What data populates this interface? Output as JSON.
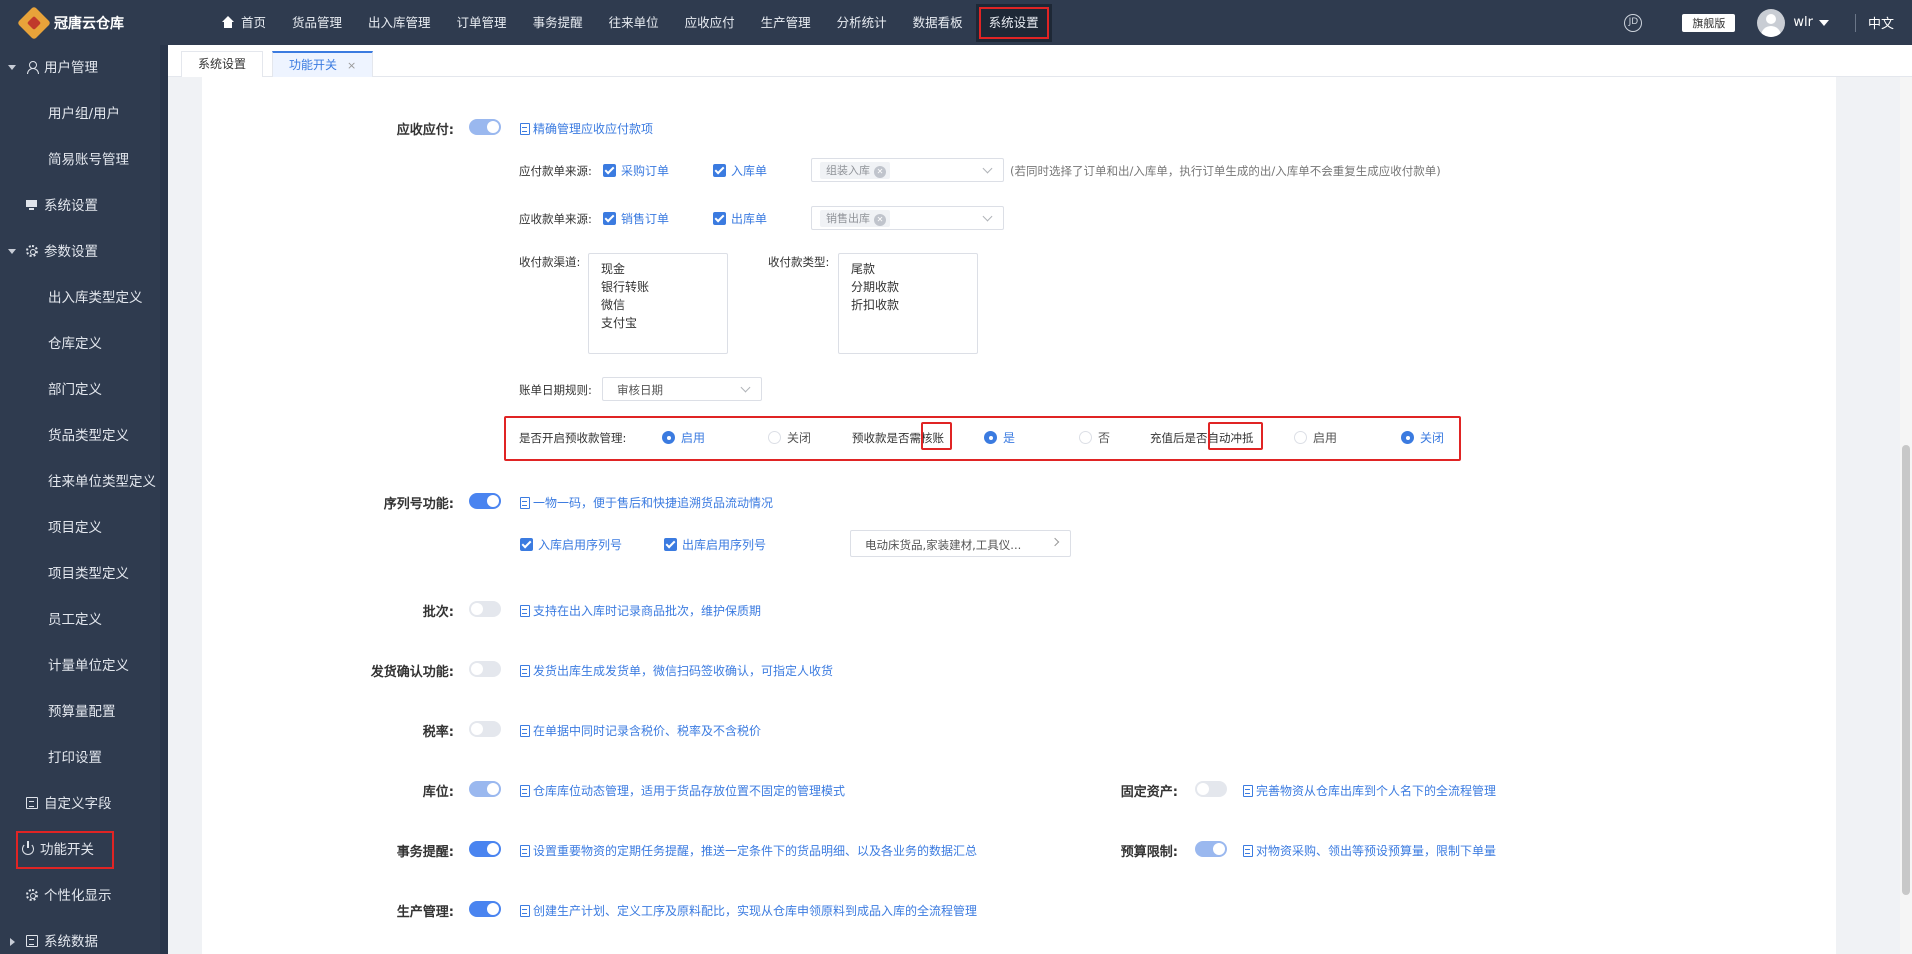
{
  "app": {
    "title": "冠唐云仓库"
  },
  "topnav": {
    "items": [
      "首页",
      "货品管理",
      "出入库管理",
      "订单管理",
      "事务提醒",
      "往来单位",
      "应收应付",
      "生产管理",
      "分析统计",
      "数据看板",
      "系统设置"
    ],
    "help_icon": "JD",
    "edition": "旗舰版",
    "user": "wlr",
    "lang": "中文"
  },
  "sidebar": {
    "items": [
      {
        "label": "用户管理",
        "icon": "user-icon"
      },
      {
        "label": "用户组/用户"
      },
      {
        "label": "简易账号管理"
      },
      {
        "label": "系统设置",
        "icon": "monitor-icon"
      },
      {
        "label": "参数设置",
        "icon": "gear-icon"
      },
      {
        "label": "出入库类型定义"
      },
      {
        "label": "仓库定义"
      },
      {
        "label": "部门定义"
      },
      {
        "label": "货品类型定义"
      },
      {
        "label": "往来单位类型定义"
      },
      {
        "label": "项目定义"
      },
      {
        "label": "项目类型定义"
      },
      {
        "label": "员工定义"
      },
      {
        "label": "计量单位定义"
      },
      {
        "label": "预算量配置"
      },
      {
        "label": "打印设置"
      },
      {
        "label": "自定义字段",
        "icon": "doc-icon"
      },
      {
        "label": "功能开关",
        "icon": "power-icon"
      },
      {
        "label": "个性化显示",
        "icon": "gear-icon"
      },
      {
        "label": "系统数据",
        "icon": "doc-icon"
      }
    ]
  },
  "tabs": [
    {
      "label": "系统设置"
    },
    {
      "label": "功能开关",
      "close": "×"
    }
  ],
  "settings": {
    "ar_ap": {
      "label": "应收应付:",
      "enabled": true,
      "desc": "精确管理应收应付款项",
      "payable_source_label": "应付款单来源:",
      "payable_opt1": "采购订单",
      "payable_opt2": "入库单",
      "payable_tag": "组装入库",
      "note": "(若同时选择了订单和出/入库单，执行订单生成的出/入库单不会重复生成应收付款单)",
      "receivable_source_label": "应收款单来源:",
      "receivable_opt1": "销售订单",
      "receivable_opt2": "出库单",
      "receivable_tag": "销售出库",
      "channel_label": "收付款渠道:",
      "channels": [
        "现金",
        "银行转账",
        "微信",
        "支付宝"
      ],
      "type_label": "收付款类型:",
      "types": [
        "尾款",
        "分期收款",
        "折扣收款"
      ],
      "date_rule_label": "账单日期规则:",
      "date_rule_value": "审核日期",
      "prepay_label": "是否开启预收款管理:",
      "prepay_on": "启用",
      "prepay_off": "关闭",
      "prepay_verify_label": "预收款是否需核账",
      "verify_yes": "是",
      "verify_no": "否",
      "recharge_label": "充值后是否自动冲抵",
      "recharge_on": "启用",
      "recharge_off": "关闭"
    },
    "serial": {
      "label": "序列号功能:",
      "enabled": true,
      "desc": "一物一码，便于售后和快捷追溯货品流动情况",
      "opt_in": "入库启用序列号",
      "opt_out": "出库启用序列号",
      "scope": "电动床货品,家装建材,工具仪..."
    },
    "batch": {
      "label": "批次:",
      "enabled": false,
      "desc": "支持在出入库时记录商品批次，维护保质期"
    },
    "delivery": {
      "label": "发货确认功能:",
      "enabled": false,
      "desc": "发货出库生成发货单，微信扫码签收确认，可指定人收货"
    },
    "tax": {
      "label": "税率:",
      "enabled": false,
      "desc": "在单据中同时记录含税价、税率及不含税价"
    },
    "location": {
      "label": "库位:",
      "enabled": true,
      "desc": "仓库库位动态管理，适用于货品存放位置不固定的管理模式"
    },
    "fixed_asset": {
      "label": "固定资产:",
      "enabled": false,
      "desc": "完善物资从仓库出库到个人名下的全流程管理"
    },
    "reminder": {
      "label": "事务提醒:",
      "enabled": true,
      "desc": "设置重要物资的定期任务提醒，推送一定条件下的货品明细、以及各业务的数据汇总"
    },
    "budget": {
      "label": "预算限制:",
      "enabled": true,
      "desc": "对物资采购、领出等预设预算量，限制下单量"
    },
    "production": {
      "label": "生产管理:",
      "enabled": true,
      "desc": "创建生产计划、定义工序及原料配比，实现从仓库申领原料到成品入库的全流程管理"
    }
  },
  "colors": {
    "accent": "#3b7be0",
    "highlight": "#e02424",
    "nav_bg": "#2f3b4f"
  }
}
